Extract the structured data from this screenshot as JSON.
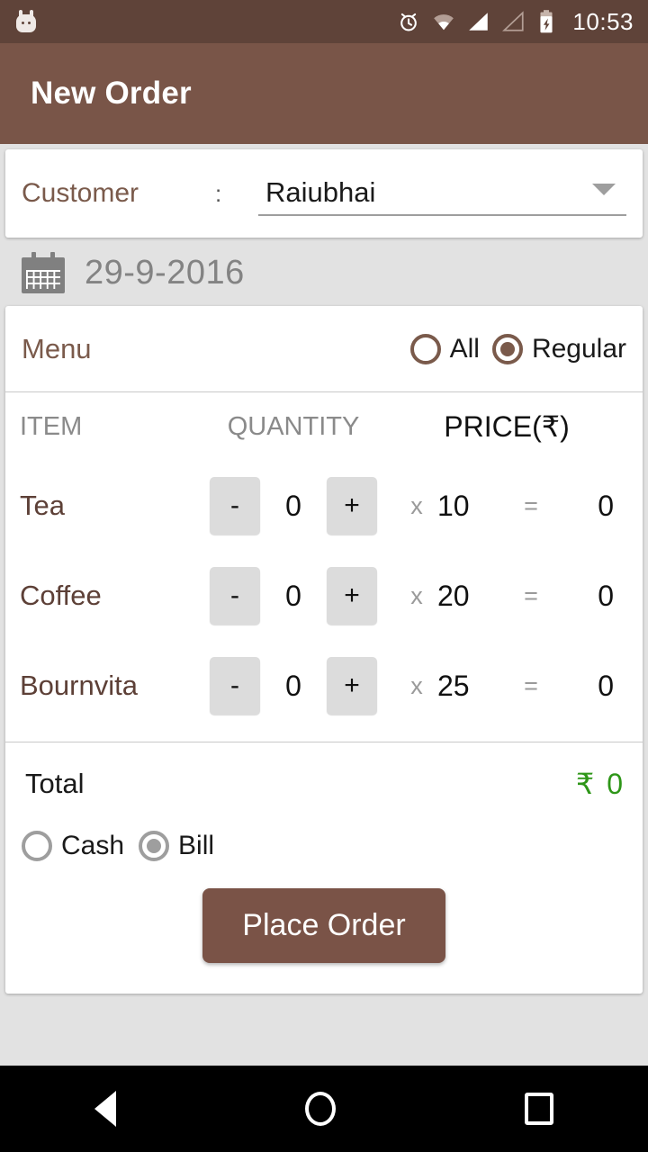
{
  "statusbar": {
    "mascot_icon": "android-mascot-icon",
    "icons": [
      "alarm-icon",
      "wifi-icon",
      "signal-full-icon",
      "signal-empty-icon",
      "battery-charging-icon"
    ],
    "time": "10:53"
  },
  "actionbar": {
    "title": "New Order"
  },
  "customer": {
    "label": "Customer",
    "colon": ":",
    "value": "Raiubhai",
    "arrow_icon": "chevron-down-icon"
  },
  "date": {
    "icon": "calendar-icon",
    "text": "29-9-2016"
  },
  "menu": {
    "title": "Menu",
    "filters": [
      {
        "label": "All",
        "selected": false
      },
      {
        "label": "Regular",
        "selected": true
      }
    ]
  },
  "table": {
    "headers": {
      "item": "ITEM",
      "quantity": "QUANTITY",
      "price": "PRICE(₹)"
    },
    "decrement_label": "-",
    "increment_label": "+",
    "multiply_symbol": "x",
    "equals_symbol": "=",
    "rows": [
      {
        "name": "Tea",
        "qty": "0",
        "price": "10",
        "total": "0"
      },
      {
        "name": "Coffee",
        "qty": "0",
        "price": "20",
        "total": "0"
      },
      {
        "name": "Bournvita",
        "qty": "0",
        "price": "25",
        "total": "0"
      }
    ]
  },
  "total": {
    "label": "Total",
    "currency": "₹",
    "value": "0",
    "color": "#2e9618"
  },
  "payment": {
    "options": [
      {
        "label": "Cash",
        "selected": false
      },
      {
        "label": "Bill",
        "selected": true
      }
    ]
  },
  "actions": {
    "place_order": "Place Order"
  },
  "navbar": {
    "back": "back-icon",
    "home": "home-icon",
    "recents": "recents-icon"
  },
  "colors": {
    "primary": "#795548",
    "primary_dark": "#5f4339",
    "accent_text": "#7a5a4b",
    "item_text": "#5d4037",
    "total_green": "#2e9618",
    "background": "#e2e2e2"
  }
}
